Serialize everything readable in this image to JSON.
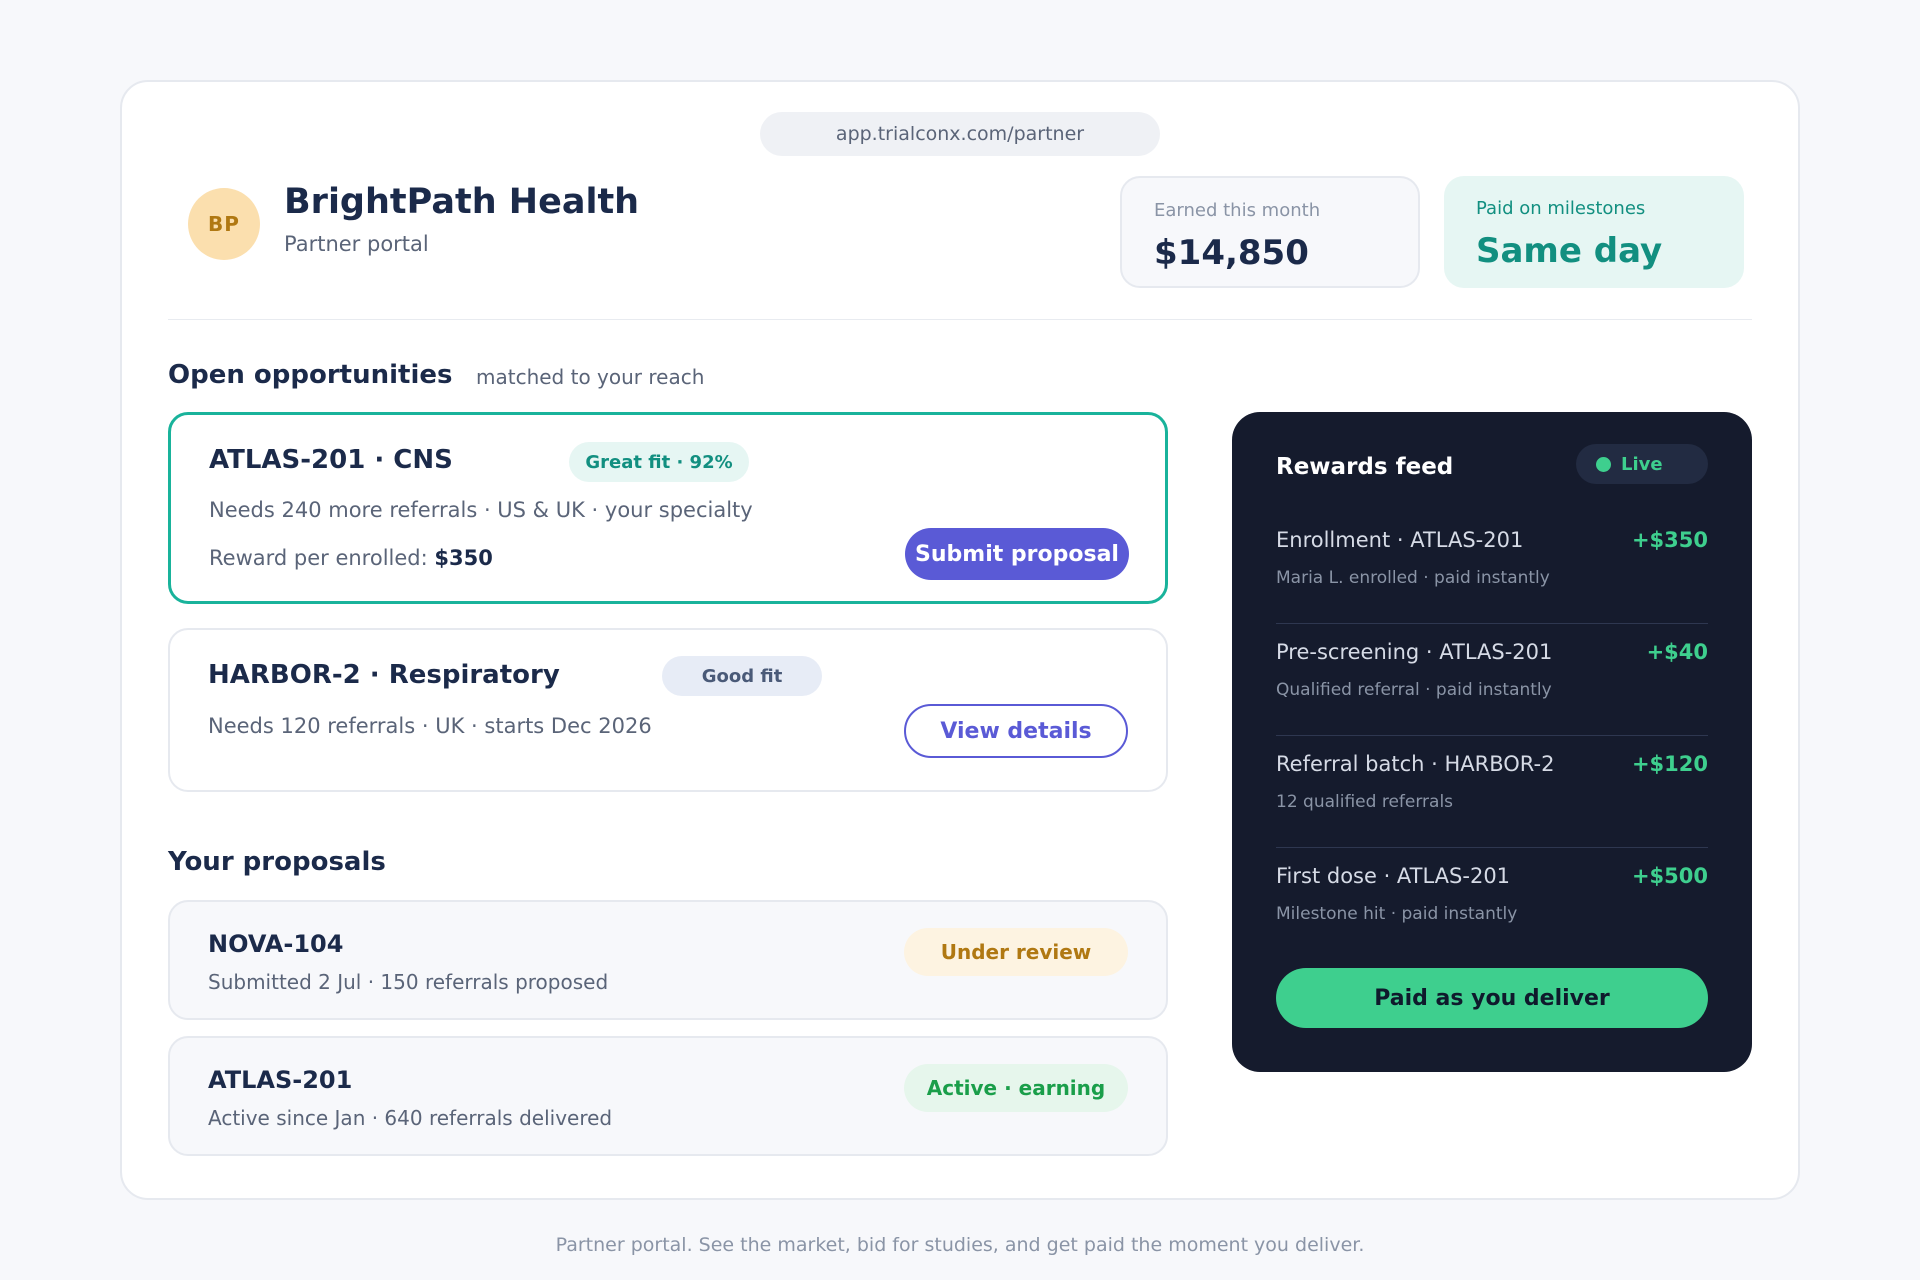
{
  "browser": {
    "url": "app.trialconx.com/partner"
  },
  "header": {
    "avatar_initials": "BP",
    "org_name": "BrightPath Health",
    "subtitle": "Partner portal"
  },
  "stats": {
    "earned": {
      "label": "Earned this month",
      "value": "$14,850"
    },
    "paid": {
      "label": "Paid on milestones",
      "value": "Same day"
    }
  },
  "opportunities": {
    "title": "Open opportunities",
    "subtitle": "matched to your reach",
    "items": [
      {
        "title": "ATLAS-201 · CNS",
        "fit": "Great fit · 92%",
        "details": "Needs 240 more referrals · US & UK · your specialty",
        "reward_label": "Reward per enrolled:",
        "reward_value": "$350",
        "action": "Submit proposal"
      },
      {
        "title": "HARBOR-2 · Respiratory",
        "fit": "Good fit",
        "details": "Needs 120 referrals · UK · starts Dec 2026",
        "action": "View details"
      }
    ]
  },
  "proposals": {
    "title": "Your proposals",
    "items": [
      {
        "title": "NOVA-104",
        "details": "Submitted 2 Jul · 150 referrals proposed",
        "status": "Under review"
      },
      {
        "title": "ATLAS-201",
        "details": "Active since Jan · 640 referrals delivered",
        "status": "Active · earning"
      }
    ]
  },
  "feed": {
    "title": "Rewards feed",
    "live_label": "Live",
    "items": [
      {
        "name": "Enrollment · ATLAS-201",
        "amount": "+$350",
        "sub": "Maria L. enrolled · paid instantly"
      },
      {
        "name": "Pre-screening · ATLAS-201",
        "amount": "+$40",
        "sub": "Qualified referral · paid instantly"
      },
      {
        "name": "Referral batch · HARBOR-2",
        "amount": "+$120",
        "sub": "12 qualified referrals"
      },
      {
        "name": "First dose · ATLAS-201",
        "amount": "+$500",
        "sub": "Milestone hit · paid instantly"
      }
    ],
    "cta": "Paid as you deliver"
  },
  "footer": "Partner portal. See the market, bid for studies, and get paid the moment you deliver.",
  "colors": {
    "accent_primary": "#5a5ad6",
    "accent_teal": "#19b39b",
    "feed_bg": "#151b2d",
    "feed_green": "#3ecf8e"
  }
}
